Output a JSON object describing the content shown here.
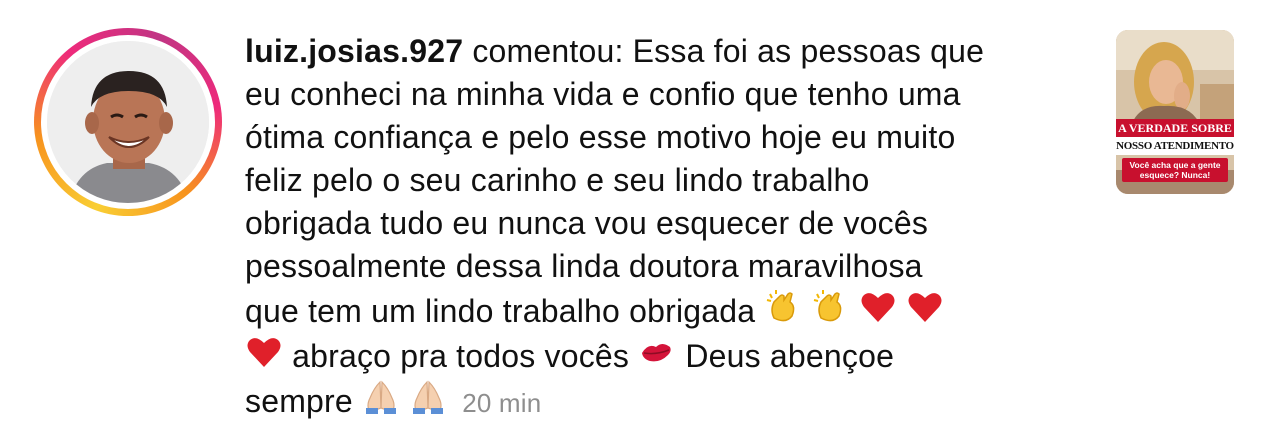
{
  "notification": {
    "username": "luiz.josias.927",
    "action": "comentou:",
    "comment_lines": [
      "Essa foi as pessoas que",
      "eu conheci na minha vida e confio que tenho uma",
      "ótima confiança e pelo esse motivo hoje eu muito",
      "feliz pelo o seu carinho e seu lindo trabalho",
      "obrigada tudo eu nunca vou esquecer de vocês",
      "pessoalmente dessa linda doutora maravilhosa",
      "que tem um lindo trabalho obrigada"
    ],
    "line8_text": "abraço pra todos vocês",
    "line8_tail": "Deus abençoe",
    "line9_text": "sempre",
    "timestamp": "20 min",
    "emojis": [
      "clapping-hands",
      "clapping-hands",
      "red-heart",
      "red-heart",
      "red-heart",
      "kiss-mark",
      "folded-hands",
      "folded-hands"
    ]
  },
  "post_thumbnail": {
    "banner_line1": "A VERDADE SOBRE",
    "banner_line2": "NOSSO ATENDIMENTO",
    "banner_sub": "Você acha que a gente esquece? Nunca!"
  },
  "colors": {
    "text": "#111111",
    "timestamp": "#8e8e8e",
    "ring": [
      "#f9ce34",
      "#ee2a7b",
      "#c13584"
    ],
    "banner_red": "#c8102e"
  }
}
